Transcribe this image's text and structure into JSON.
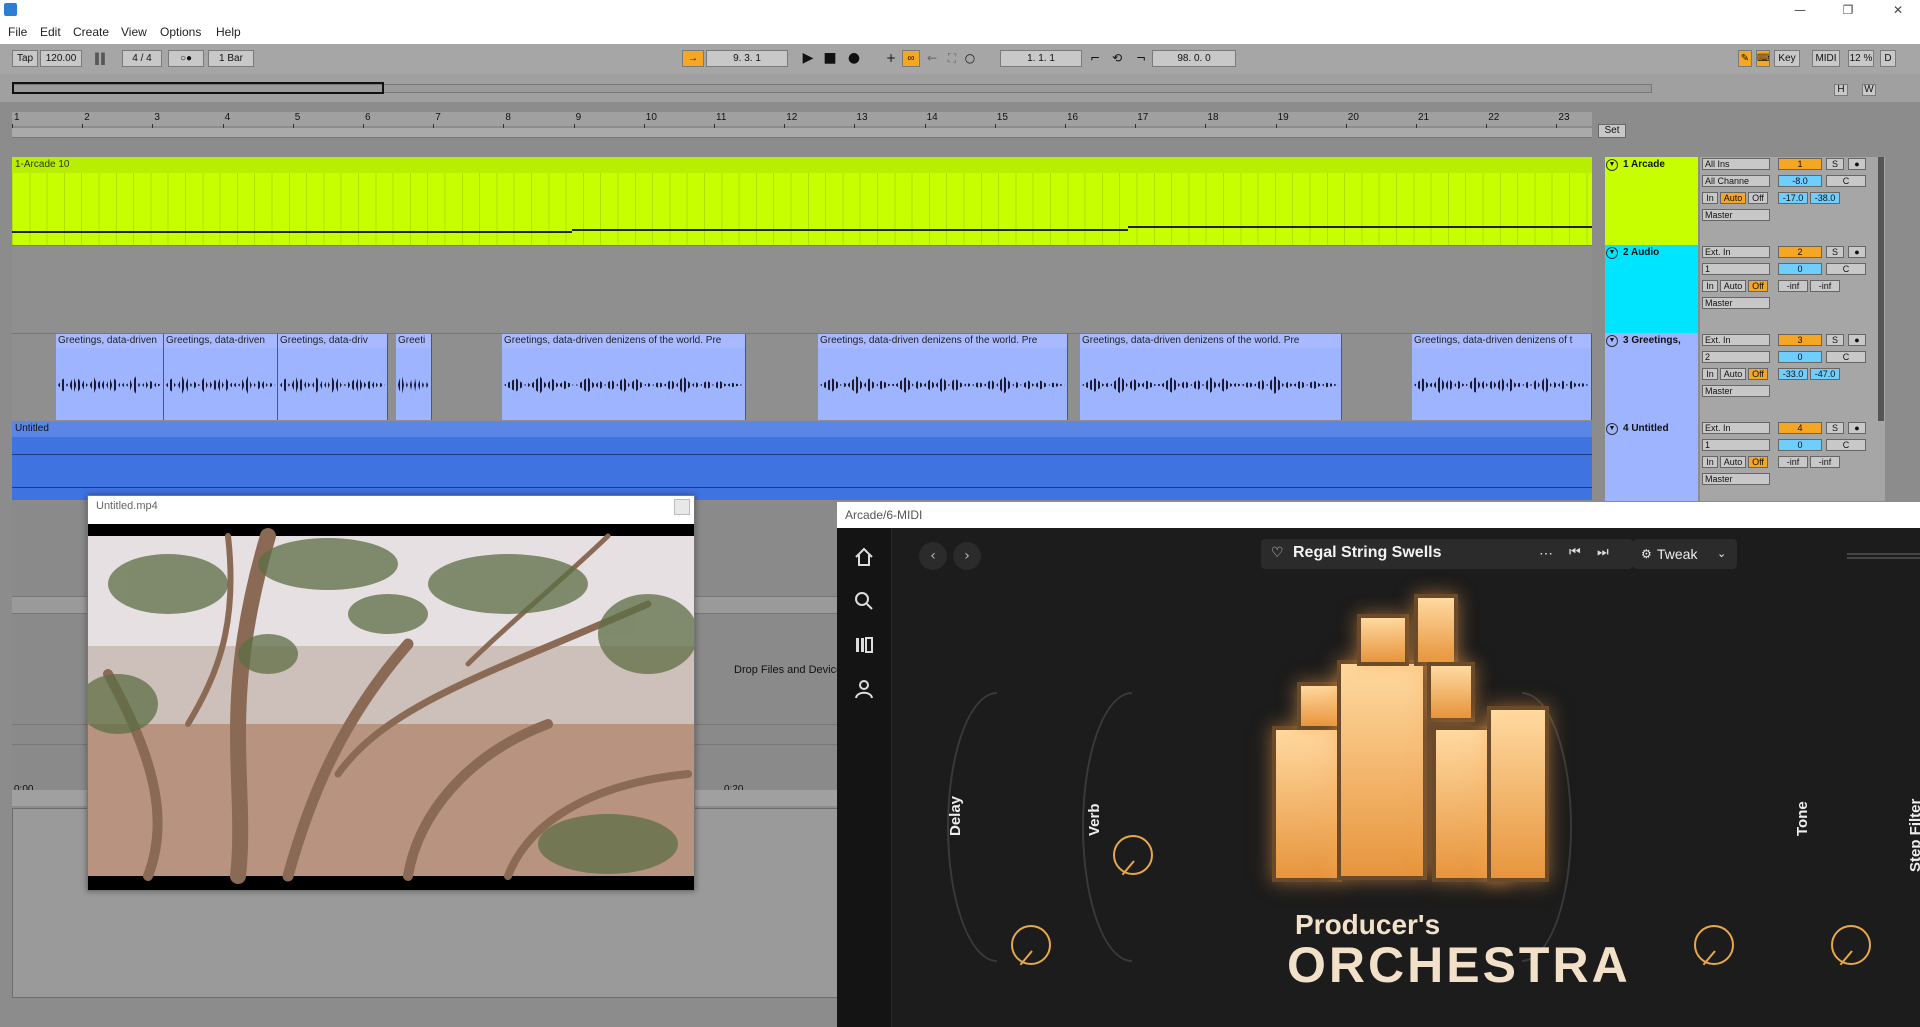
{
  "window": {
    "close": "✕",
    "restore": "❐",
    "minimize": "—"
  },
  "menu": [
    "File",
    "Edit",
    "Create",
    "View",
    "Options",
    "Help"
  ],
  "transport": {
    "tap": "Tap",
    "tempo": "120.00",
    "signature": "4 / 4",
    "metronome_glyph": "○●",
    "quantize": "1 Bar",
    "arrangement_position": "9.   3.   1",
    "loop_start": "1.   1.   1",
    "loop_length": "98.   0.   0",
    "key": "Key",
    "midi": "MIDI",
    "cpu": "12 %",
    "d": "D"
  },
  "ruler": {
    "bars": [
      "1",
      "2",
      "3",
      "4",
      "5",
      "6",
      "7",
      "8",
      "9",
      "10",
      "11",
      "12",
      "13",
      "14",
      "15",
      "16",
      "17",
      "18",
      "19",
      "20",
      "21",
      "22",
      "23"
    ],
    "set": "Set"
  },
  "time_labels": [
    "0:00",
    "0:20"
  ],
  "tracks": [
    {
      "clip_name": "1-Arcade 10",
      "head": "1 Arcade",
      "input": "All Ins",
      "channel": "All Channe",
      "output": "Master",
      "number": "1",
      "vol": "-8.0",
      "pan": "C",
      "meter_l": "-17.0",
      "meter_r": "-38.0",
      "mon_in": "In",
      "mon_auto": "Auto",
      "mon_off": "Off",
      "color": "#c8ff00"
    },
    {
      "head": "2 Audio",
      "input": "Ext. In",
      "channel": "1",
      "output": "Master",
      "number": "2",
      "vol": "0",
      "pan": "C",
      "meter_l": "-inf",
      "meter_r": "-inf",
      "mon_in": "In",
      "mon_auto": "Auto",
      "mon_off": "Off",
      "color": "#00e5ff"
    },
    {
      "head": "3 Greetings,",
      "input": "Ext. In",
      "channel": "2",
      "output": "Master",
      "number": "3",
      "vol": "0",
      "pan": "C",
      "meter_l": "-33.0",
      "meter_r": "-47.0",
      "mon_in": "In",
      "mon_auto": "Auto",
      "mon_off": "Off",
      "color": "#9fb4ff"
    },
    {
      "clip_name": "Untitled",
      "head": "4 Untitled",
      "input": "Ext. In",
      "channel": "1",
      "output": "Master",
      "number": "4",
      "vol": "0",
      "pan": "C",
      "meter_l": "-inf",
      "meter_r": "-inf",
      "mon_in": "In",
      "mon_auto": "Auto",
      "mon_off": "Off",
      "color": "#3f73e0"
    }
  ],
  "track3_clips": [
    "Greetings, data-driven",
    "Greetings, data-driven",
    "Greetings, data-driv",
    "Greeti",
    "Greetings, data-driven denizens of the world. Pre",
    "Greetings, data-driven denizens of the world. Pre",
    "Greetings, data-driven denizens of the world. Pre",
    "Greetings, data-driven denizens of t"
  ],
  "drop_hint": "Drop Files and Devices Here",
  "video": {
    "title": "Untitled.mp4"
  },
  "plugin": {
    "window_title": "Arcade/6-MIDI",
    "preset": "Regal String Swells",
    "tweak": "Tweak",
    "knobs": [
      "Delay",
      "Verb",
      "Tone",
      "Step Filter"
    ],
    "product_line1": "Producer's",
    "product_line2": "ORCHESTRA"
  },
  "colors": {
    "accent": "#f5a623",
    "arrange_bg": "#8c8c8c",
    "plugin_bg": "#1c1c1c",
    "knob": "#e8a84a"
  }
}
